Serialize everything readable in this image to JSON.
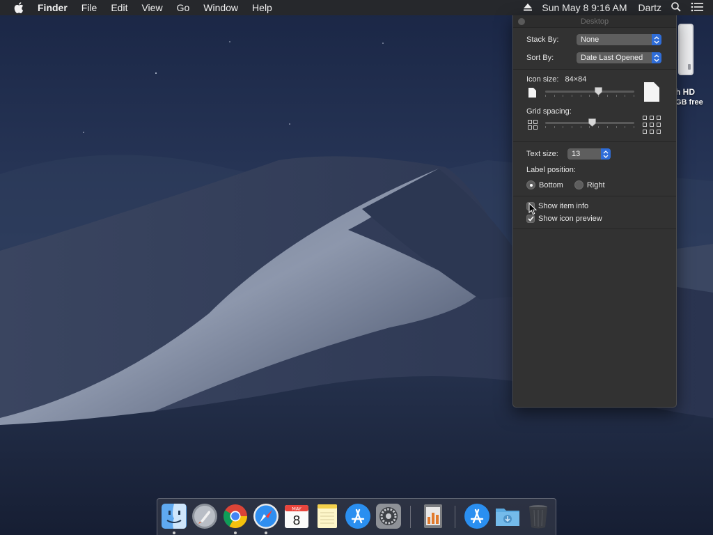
{
  "menubar": {
    "app_name": "Finder",
    "menus": [
      "File",
      "Edit",
      "View",
      "Go",
      "Window",
      "Help"
    ],
    "clock": "Sun May 8  9:16 AM",
    "user": "Dartz",
    "icons": [
      "apple-icon",
      "eject-icon",
      "spotlight-search-icon",
      "notification-center-icon"
    ]
  },
  "desktop": {
    "disk_label": "h HD",
    "disk_sub": "GB free"
  },
  "view_options": {
    "title": "Desktop",
    "stack_by_label": "Stack By:",
    "stack_by_value": "None",
    "sort_by_label": "Sort By:",
    "sort_by_value": "Date Last Opened",
    "icon_size_label": "Icon size:",
    "icon_size_value": "84×84",
    "icon_size_fraction": 0.6,
    "grid_spacing_label": "Grid spacing:",
    "grid_spacing_fraction": 0.53,
    "text_size_label": "Text size:",
    "text_size_value": "13",
    "label_position_label": "Label position:",
    "label_positions": [
      {
        "label": "Bottom",
        "selected": true
      },
      {
        "label": "Right",
        "selected": false
      }
    ],
    "checkboxes": [
      {
        "label": "Show item info",
        "checked": false
      },
      {
        "label": "Show icon preview",
        "checked": true
      }
    ]
  },
  "dock": {
    "apps": [
      {
        "name": "Finder",
        "icon": "finder-icon",
        "running": true
      },
      {
        "name": "Launchpad",
        "icon": "launchpad-icon",
        "running": false
      },
      {
        "name": "Google Chrome",
        "icon": "chrome-icon",
        "running": true
      },
      {
        "name": "Safari",
        "icon": "safari-icon",
        "running": true
      },
      {
        "name": "Calendar",
        "icon": "calendar-icon",
        "running": false,
        "month": "MAY",
        "day": "8"
      },
      {
        "name": "Notes",
        "icon": "notes-icon",
        "running": false
      },
      {
        "name": "App Store",
        "icon": "app-store-icon",
        "running": false
      },
      {
        "name": "System Preferences",
        "icon": "system-preferences-icon",
        "running": false
      },
      {
        "name": "Numbers",
        "icon": "spreadsheet-icon",
        "running": false
      },
      {
        "name": "Applications",
        "icon": "applications-folder-icon",
        "running": false
      },
      {
        "name": "Downloads",
        "icon": "downloads-folder-icon",
        "running": false
      },
      {
        "name": "Trash",
        "icon": "trash-icon",
        "running": false
      }
    ]
  },
  "colors": {
    "accent": "#2f6dd8",
    "panel_bg": "#323232",
    "menubar_bg": "#26282c"
  }
}
